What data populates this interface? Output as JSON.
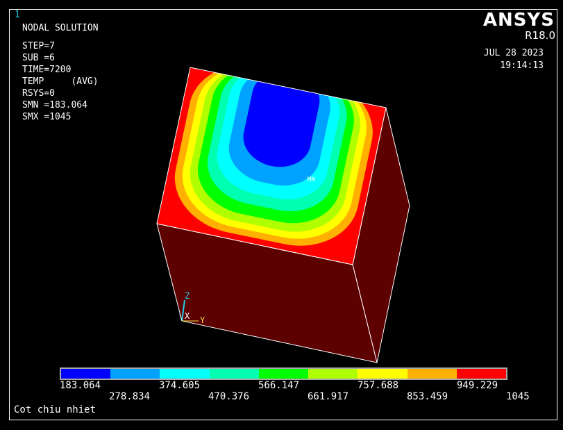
{
  "window_number": "1",
  "brand": "ANSYS",
  "version": "R18.0",
  "date": "JUL 28 2023",
  "time": "19:14:13",
  "plot_title": "NODAL SOLUTION",
  "info_lines": [
    "STEP=7",
    "SUB =6",
    "TIME=7200",
    "TEMP     (AVG)",
    "RSYS=0",
    "SMN =183.064",
    "SMX =1045"
  ],
  "min_marker": "MN",
  "axes": {
    "z": "Z",
    "x": "X",
    "y": "Y"
  },
  "legend": {
    "colors": [
      "#0000ff",
      "#00a2ff",
      "#00ffff",
      "#00ffb0",
      "#00ff00",
      "#b0ff00",
      "#ffff00",
      "#ffb000",
      "#ff0000"
    ],
    "top_labels": [
      "183.064",
      "374.605",
      "566.147",
      "757.688",
      "949.229"
    ],
    "bottom_labels": [
      "278.834",
      "470.376",
      "661.917",
      "853.459",
      "1045"
    ]
  },
  "caption": "Cot chiu nhiet",
  "colors": {
    "hot_face": "#5c0000",
    "frame": "#ffffff",
    "window_number": "#22d0e6"
  }
}
